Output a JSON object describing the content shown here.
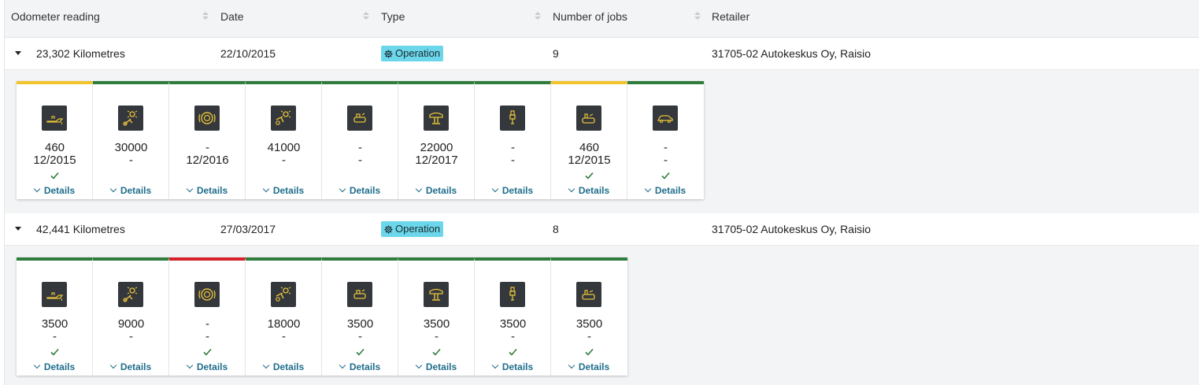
{
  "headers": {
    "odometer": "Odometer reading",
    "date": "Date",
    "type": "Type",
    "jobs": "Number of jobs",
    "retailer": "Retailer"
  },
  "colors": {
    "ok": "#2e7d3c",
    "warning": "#f2c42c",
    "overdue": "#d6212b",
    "badge": "#6cd7ea",
    "icon_tile": "#34383c",
    "icon_glyph": "#e8c23a",
    "link": "#1f6e8c"
  },
  "details_label": "Details",
  "rows": [
    {
      "odometer": "23,302 Kilometres",
      "date": "22/10/2015",
      "type": "Operation",
      "type_icon": "gear-icon",
      "jobs": "9",
      "retailer": "31705-02 Autokeskus Oy, Raisio",
      "services": [
        {
          "icon": "oil-can-icon",
          "status": "warning",
          "value1": "460",
          "value2": "12/2015",
          "done": true
        },
        {
          "icon": "gearbox-wrench-icon",
          "status": "ok",
          "value1": "30000",
          "value2": "-",
          "done": false
        },
        {
          "icon": "brake-disc-icon",
          "status": "ok",
          "value1": "-",
          "value2": "12/2016",
          "done": false
        },
        {
          "icon": "timing-gear-icon",
          "status": "ok",
          "value1": "41000",
          "value2": "-",
          "done": false
        },
        {
          "icon": "fuel-filter-icon",
          "status": "ok",
          "value1": "-",
          "value2": "-",
          "done": false
        },
        {
          "icon": "car-lift-icon",
          "status": "ok",
          "value1": "22000",
          "value2": "12/2017",
          "done": false
        },
        {
          "icon": "spark-plug-icon",
          "status": "ok",
          "value1": "-",
          "value2": "-",
          "done": false
        },
        {
          "icon": "oil-filter-icon",
          "status": "warning",
          "value1": "460",
          "value2": "12/2015",
          "done": true
        },
        {
          "icon": "car-icon",
          "status": "ok",
          "value1": "-",
          "value2": "-",
          "done": true
        }
      ]
    },
    {
      "odometer": "42,441 Kilometres",
      "date": "27/03/2017",
      "type": "Operation",
      "type_icon": "gear-icon",
      "jobs": "8",
      "retailer": "31705-02 Autokeskus Oy, Raisio",
      "services": [
        {
          "icon": "oil-can-icon",
          "status": "ok",
          "value1": "3500",
          "value2": "-",
          "done": true
        },
        {
          "icon": "gearbox-wrench-icon",
          "status": "ok",
          "value1": "9000",
          "value2": "-",
          "done": false
        },
        {
          "icon": "brake-disc-icon",
          "status": "overdue",
          "value1": "-",
          "value2": "-",
          "done": true
        },
        {
          "icon": "timing-gear-icon",
          "status": "ok",
          "value1": "18000",
          "value2": "-",
          "done": false
        },
        {
          "icon": "fuel-filter-icon",
          "status": "ok",
          "value1": "3500",
          "value2": "-",
          "done": true
        },
        {
          "icon": "car-lift-icon",
          "status": "ok",
          "value1": "3500",
          "value2": "-",
          "done": true
        },
        {
          "icon": "spark-plug-icon",
          "status": "ok",
          "value1": "3500",
          "value2": "-",
          "done": true
        },
        {
          "icon": "oil-filter-icon",
          "status": "ok",
          "value1": "3500",
          "value2": "-",
          "done": true
        }
      ]
    }
  ]
}
